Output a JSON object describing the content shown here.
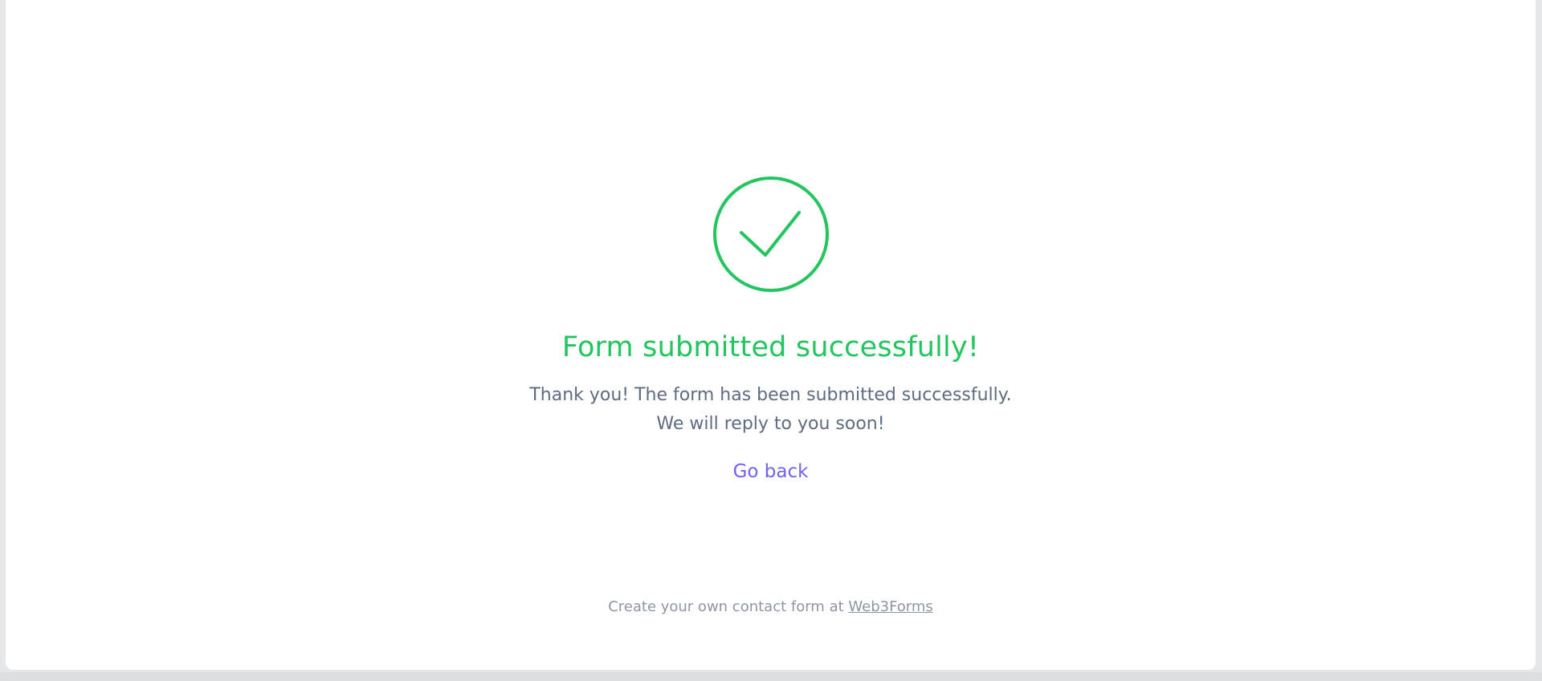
{
  "status": {
    "icon": "check-circle-icon",
    "color": "#22c55e"
  },
  "title": "Form submitted successfully!",
  "message": {
    "line1": "Thank you! The form has been submitted successfully.",
    "line2": "We will reply to you soon!"
  },
  "go_back_label": "Go back",
  "footer": {
    "text": "Create your own contact form at ",
    "link_label": "Web3Forms"
  },
  "colors": {
    "success": "#22c55e",
    "link": "#6f62f2",
    "body_text": "#5f6b80",
    "muted_text": "#8e96a4"
  }
}
